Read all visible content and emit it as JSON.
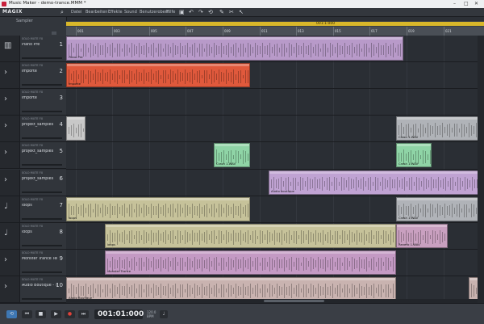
{
  "window": {
    "title": "Music Maker - demo-trance.MMM *",
    "controls": [
      "–",
      "□",
      "✕"
    ]
  },
  "menu": {
    "brand": "MAGIX",
    "items": [
      "Datei",
      "Bearbeiten",
      "Effekte",
      "Sound",
      "Benutzeroberf.",
      "Hilfe"
    ]
  },
  "toolbar": {
    "icons": [
      "save-icon",
      "undo-icon",
      "redo-icon",
      "cut-icon",
      "draw-icon",
      "select-icon"
    ]
  },
  "header": {
    "label": "Sampler",
    "zoom": ""
  },
  "loop": {
    "label": "001:1:000"
  },
  "ruler": {
    "labels": [
      "001",
      "003",
      "005",
      "007",
      "009",
      "011",
      "013",
      "015",
      "017",
      "019",
      "021"
    ]
  },
  "tracks": [
    {
      "name": "Piano Pre",
      "number": "1",
      "icon": "piano-icon",
      "buttons": "SOLO MUTE FX"
    },
    {
      "name": "Importe",
      "number": "2",
      "icon": "",
      "buttons": "SOLO MUTE FX"
    },
    {
      "name": "Importe",
      "number": "3",
      "icon": "",
      "buttons": "SOLO MUTE FX"
    },
    {
      "name": "projekt_samples",
      "number": "4",
      "icon": "",
      "buttons": "SOLO MUTE FX"
    },
    {
      "name": "projekt_samples",
      "number": "5",
      "icon": "",
      "buttons": "SOLO MUTE FX"
    },
    {
      "name": "projekt_samples",
      "number": "6",
      "icon": "",
      "buttons": "SOLO MUTE FX"
    },
    {
      "name": "loops",
      "number": "7",
      "icon": "note-icon",
      "buttons": "SOLO MUTE FX"
    },
    {
      "name": "loops",
      "number": "8",
      "icon": "note-icon",
      "buttons": "SOLO MUTE FX"
    },
    {
      "name": "Monster Trance Ter",
      "number": "9",
      "icon": "",
      "buttons": "SOLO MUTE FX"
    },
    {
      "name": "Audio Boutique - Te",
      "number": "10",
      "icon": "",
      "buttons": "SOLO MUTE FX"
    }
  ],
  "clips": [
    {
      "track": 0,
      "start": 0,
      "end": 418,
      "color": "#b89ac9",
      "name": "Piano Pre"
    },
    {
      "track": 1,
      "start": 0,
      "end": 228,
      "color": "#e0593c",
      "name": "Importe"
    },
    {
      "track": 3,
      "start": 0,
      "end": 24,
      "color": "#c8c8c8",
      "name": ""
    },
    {
      "track": 3,
      "start": 409,
      "end": 518,
      "color": "#b0b3b8",
      "name": "Crash 1.WAV"
    },
    {
      "track": 4,
      "start": 183,
      "end": 228,
      "color": "#8fd4a6",
      "name": "Crash 1.WAV"
    },
    {
      "track": 4,
      "start": 409,
      "end": 453,
      "color": "#8fd4a6",
      "name": "Crash 1.WAV"
    },
    {
      "track": 5,
      "start": 251,
      "end": 518,
      "color": "#c0a3d3",
      "name": "Audio boutique"
    },
    {
      "track": 6,
      "start": 0,
      "end": 228,
      "color": "#c6c29a",
      "name": "loops"
    },
    {
      "track": 6,
      "start": 409,
      "end": 518,
      "color": "#b0b3b8",
      "name": "Crash 1.WAV"
    },
    {
      "track": 7,
      "start": 48,
      "end": 409,
      "color": "#c6c29a",
      "name": "loops"
    },
    {
      "track": 7,
      "start": 409,
      "end": 473,
      "color": "#c9a0c0",
      "name": "Reverb 1.WAV"
    },
    {
      "track": 8,
      "start": 48,
      "end": 409,
      "color": "#c49ac4",
      "name": "Monster Trance"
    },
    {
      "track": 9,
      "start": 0,
      "end": 409,
      "color": "#c9b3b0",
      "name": "Audio Boutique"
    },
    {
      "track": 9,
      "start": 499,
      "end": 518,
      "color": "#c9b3b0",
      "name": ""
    }
  ],
  "transport": {
    "timecode": "001:01:000",
    "bpm": "120.0",
    "bpm_label": "BPM",
    "sig": "4/4"
  }
}
